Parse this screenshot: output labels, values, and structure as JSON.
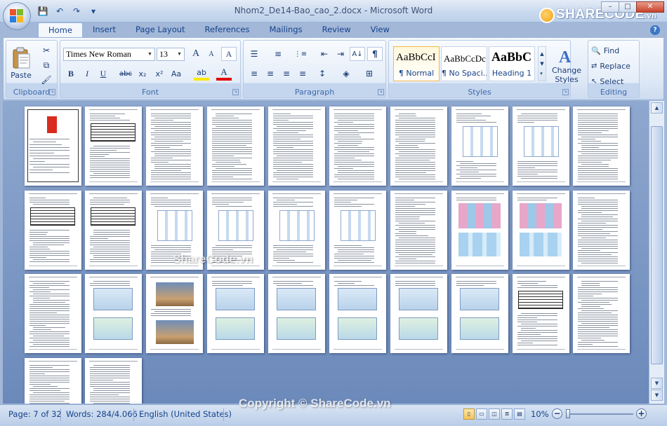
{
  "window": {
    "title": "Nhom2_De14-Bao_cao_2.docx - Microsoft Word",
    "brand_text": "SHARECODE",
    "brand_suffix": ".vn",
    "minimize": "–",
    "maximize": "□",
    "close": "✕"
  },
  "quick_access": {
    "save_icon": "💾",
    "undo_icon": "↶",
    "redo_icon": "↷",
    "customize_icon": "▾"
  },
  "tabs": [
    "Home",
    "Insert",
    "Page Layout",
    "References",
    "Mailings",
    "Review",
    "View"
  ],
  "help": "?",
  "clipboard": {
    "label": "Clipboard",
    "paste": "Paste",
    "cut_icon": "✂",
    "copy_icon": "⧉",
    "format_painter_icon": "🖌"
  },
  "font": {
    "label": "Font",
    "family": "Times New Roman",
    "size": "13",
    "grow": "A",
    "shrink": "A",
    "clear": "A",
    "bold": "B",
    "italic": "I",
    "underline": "U",
    "strike": "abc",
    "subscript": "x₂",
    "superscript": "x²",
    "change_case": "Aa",
    "highlight": "ab",
    "font_color": "A"
  },
  "paragraph": {
    "label": "Paragraph",
    "bullets": "☰",
    "numbering": "≡",
    "multilevel": "⋮≡",
    "decrease_indent": "⇤",
    "increase_indent": "⇥",
    "sort": "A↓",
    "show_marks": "¶",
    "align_left": "≡",
    "align_center": "≡",
    "align_right": "≡",
    "justify": "≡",
    "line_spacing": "↕",
    "shading": "◈",
    "borders": "⊞"
  },
  "styles": {
    "label": "Styles",
    "items": [
      {
        "preview": "AaBbCcI",
        "name": "¶ Normal"
      },
      {
        "preview": "AaBbCcDc",
        "name": "¶ No Spaci..."
      },
      {
        "preview": "AaBbC",
        "name": "Heading 1"
      }
    ],
    "change_styles": "Change",
    "change_styles_2": "Styles"
  },
  "editing": {
    "label": "Editing",
    "find": "Find",
    "replace": "Replace",
    "select": "Select"
  },
  "status": {
    "page": "Page: 7 of 32",
    "words": "Words: 284/4.066",
    "language": "English (United States)",
    "zoom": "10%",
    "zoom_out": "−",
    "zoom_in": "+"
  },
  "watermarks": {
    "doc": "ShareCode.vn",
    "status": "Copyright © ShareCode.vn"
  }
}
